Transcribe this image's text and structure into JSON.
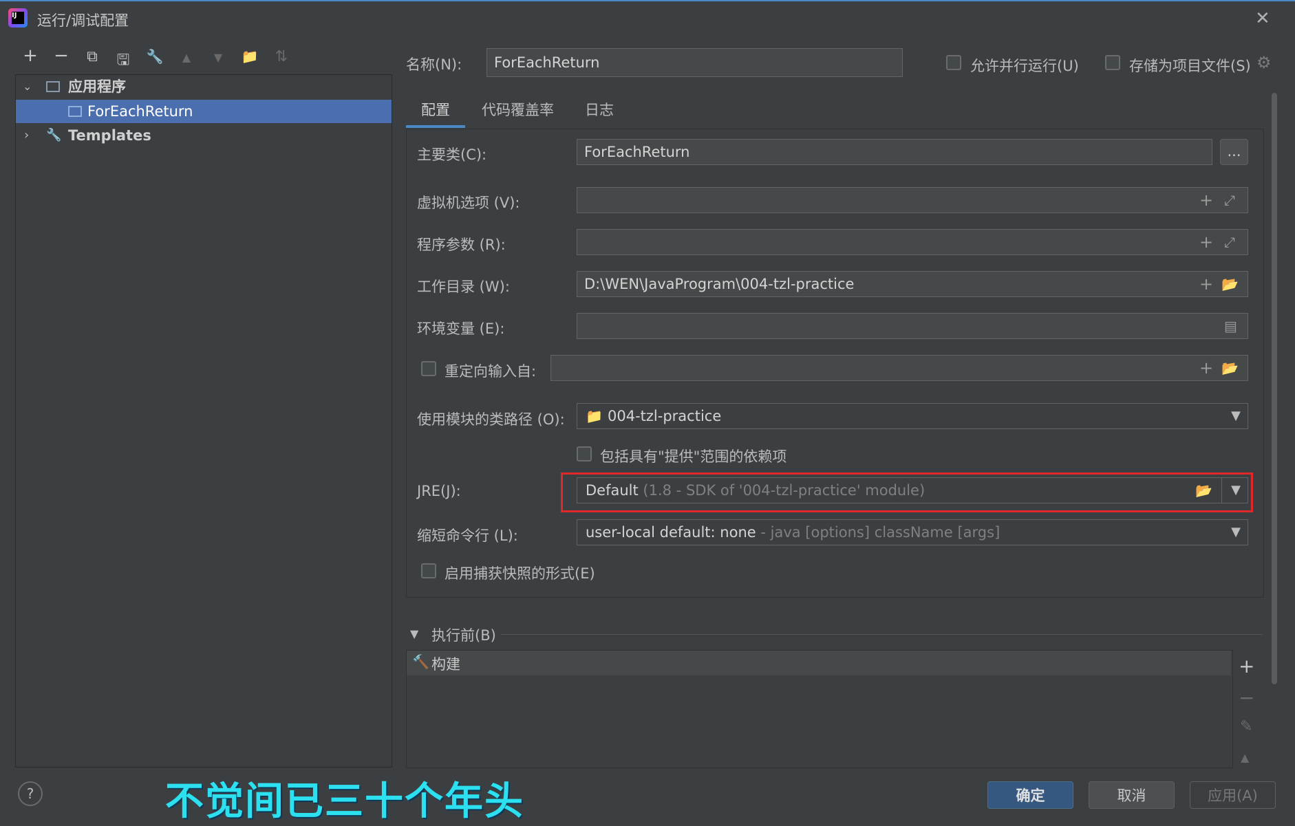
{
  "window": {
    "title": "运行/调试配置",
    "close_glyph": "✕"
  },
  "toolbar": {
    "icons": [
      {
        "name": "add-icon",
        "glyph": "+"
      },
      {
        "name": "remove-icon",
        "glyph": "−"
      },
      {
        "name": "copy-icon",
        "glyph": "⧉"
      },
      {
        "name": "save-icon",
        "glyph": "🖫"
      },
      {
        "name": "wrench-icon",
        "glyph": "🔧"
      },
      {
        "name": "move-up-icon",
        "glyph": "▲"
      },
      {
        "name": "move-down-icon",
        "glyph": "▼"
      },
      {
        "name": "new-folder-icon",
        "glyph": "📁"
      },
      {
        "name": "sort-icon",
        "glyph": "⇅"
      }
    ]
  },
  "tree": {
    "group_label": "应用程序",
    "selected_item": "ForEachReturn",
    "templates_label": "Templates"
  },
  "header": {
    "name_label": "名称(N):",
    "name_value": "ForEachReturn",
    "allow_parallel_label": "允许并行运行(U)",
    "store_as_file_label": "存储为项目文件(S)"
  },
  "tabs": [
    "配置",
    "代码覆盖率",
    "日志"
  ],
  "form": {
    "main_class_label": "主要类(C):",
    "main_class_value": "ForEachReturn",
    "browse_label": "...",
    "vm_options_label": "虚拟机选项 (V):",
    "program_args_label": "程序参数 (R):",
    "working_dir_label": "工作目录 (W):",
    "working_dir_value": "D:\\WEN\\JavaProgram\\004-tzl-practice",
    "env_vars_label": "环境变量 (E):",
    "redirect_label": "重定向输入自:",
    "module_classpath_label": "使用模块的类路径 (O):",
    "module_value": "004-tzl-practice",
    "include_provided_label": "包括具有\"提供\"范围的依赖项",
    "jre_label": "JRE(J):",
    "jre_value": "Default",
    "jre_hint": "(1.8 - SDK of '004-tzl-practice' module)",
    "shorten_label": "缩短命令行 (L):",
    "shorten_value": "user-local default: none",
    "shorten_hint": "- java [options] className [args]",
    "snapshot_label": "启用捕获快照的形式(E)"
  },
  "before_launch": {
    "title": "执行前(B)",
    "item": "构建"
  },
  "footer": {
    "help_glyph": "?",
    "subtitle": "不觉间已三十个年头",
    "ok_label": "确定",
    "cancel_label": "取消",
    "apply_label": "应用(A)"
  },
  "colors": {
    "accent": "#4b6eaf",
    "highlight_border": "#e0282b",
    "subtitle_color": "#2de0f0",
    "ok_button": "#365880"
  }
}
